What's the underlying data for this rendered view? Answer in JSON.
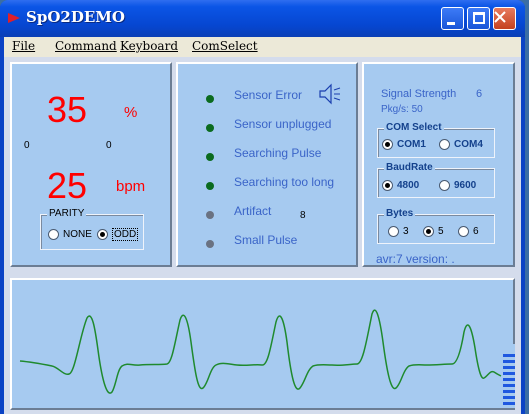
{
  "window": {
    "title": "SpO2DEMO",
    "buttons": [
      "minimize",
      "maximize",
      "close"
    ]
  },
  "menu": {
    "items": [
      "File",
      "Command",
      "Keyboard",
      "ComSelect"
    ]
  },
  "measurements": {
    "spo2_value": "35",
    "spo2_unit": "%",
    "pulse_value": "25",
    "pulse_unit": "bpm",
    "aux_left": "0",
    "aux_right": "0"
  },
  "parity": {
    "title": "PARITY",
    "options": [
      "NONE",
      "ODD"
    ],
    "selected": "ODD"
  },
  "status": {
    "items": [
      {
        "label": "Sensor Error",
        "state": "green"
      },
      {
        "label": "Sensor unplugged",
        "state": "green"
      },
      {
        "label": "Searching Pulse",
        "state": "green"
      },
      {
        "label": "Searching too long",
        "state": "green"
      },
      {
        "label": "Artifact",
        "state": "gray"
      },
      {
        "label": "Small Pulse",
        "state": "gray"
      }
    ],
    "artifact_count": "8",
    "icon": "speaker-icon"
  },
  "signal": {
    "strength_label": "Signal Strength",
    "strength_value": "6",
    "pkgs_label": "Pkg/s: 50"
  },
  "com_select": {
    "title": "COM Select",
    "options": [
      "COM1",
      "COM4"
    ],
    "selected": "COM1"
  },
  "baud_rate": {
    "title": "BaudRate",
    "options": [
      "4800",
      "9600"
    ],
    "selected": "4800"
  },
  "bytes": {
    "title": "Bytes",
    "options": [
      "3",
      "5",
      "6"
    ],
    "selected": "5"
  },
  "version": {
    "text": "avr:7  version: ."
  },
  "waveform": {
    "color": "#1f8a2e",
    "level_bars": 9
  },
  "colors": {
    "accent_red": "#ff0000",
    "panel_bg": "#a6caf0",
    "status_text": "#3a64c8"
  }
}
